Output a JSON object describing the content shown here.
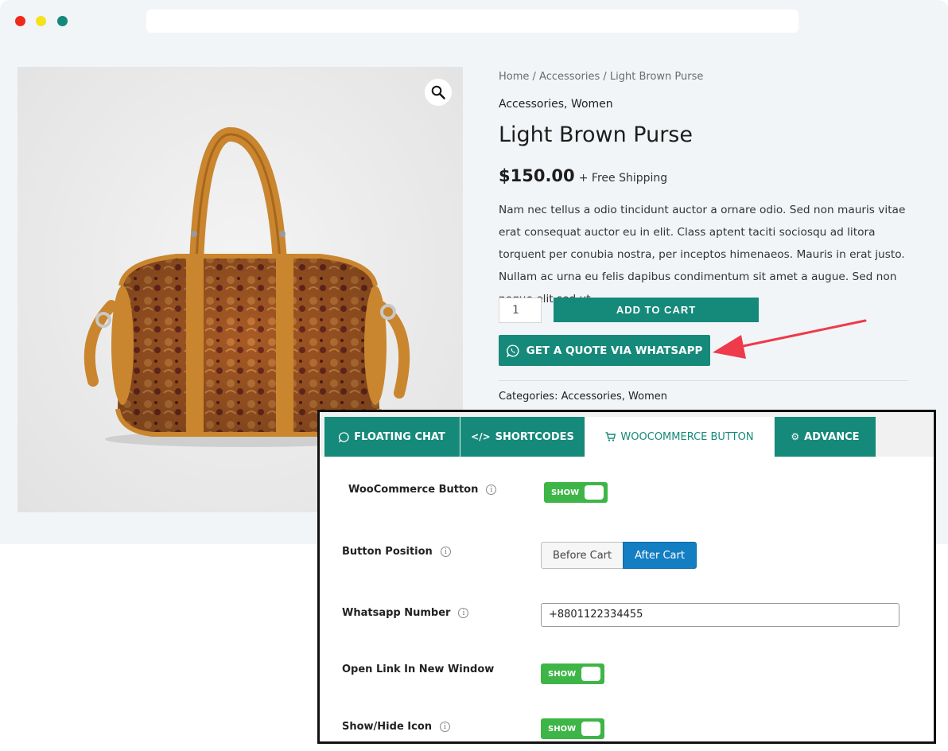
{
  "browser": {
    "address": ""
  },
  "product": {
    "breadcrumb": {
      "home": "Home",
      "sep1": " / ",
      "category": "Accessories",
      "sep2": " / ",
      "current": "Light Brown Purse"
    },
    "categories_top": "Accessories, Women",
    "title": "Light Brown Purse",
    "price": "$150.00",
    "shipping": "+ Free Shipping",
    "description": "Nam nec tellus a odio tincidunt auctor a ornare odio. Sed non mauris vitae erat consequat auctor eu in elit. Class aptent taciti sociosqu ad litora torquent per conubia nostra, per inceptos himenaeos. Mauris in erat justo. Nullam ac urna eu felis dapibus condimentum sit amet a augue. Sed non neque elit sed ut.",
    "quantity": "1",
    "add_to_cart_label": "ADD TO CART",
    "whatsapp_button_label": "GET A QUOTE VIA WHATSAPP",
    "categories_bottom": "Categories: Accessories, Women"
  },
  "settings": {
    "tabs": [
      {
        "label": "FLOATING CHAT",
        "icon": "whatsapp-icon"
      },
      {
        "label": "SHORTCODES",
        "icon": "code-icon"
      },
      {
        "label": "WOOCOMMERCE BUTTON",
        "icon": "cart-icon",
        "active": true
      },
      {
        "label": "ADVANCE",
        "icon": "gears-icon"
      }
    ],
    "woocommerce_button": {
      "label": "WooCommerce Button",
      "toggle": "SHOW"
    },
    "button_position": {
      "label": "Button Position",
      "options": [
        "Before Cart",
        "After Cart"
      ],
      "selected": "After Cart"
    },
    "whatsapp_number": {
      "label": "Whatsapp Number",
      "value": "+8801122334455"
    },
    "open_new_window": {
      "label": "Open Link In New Window",
      "toggle": "SHOW"
    },
    "show_hide_icon": {
      "label": "Show/Hide Icon",
      "toggle": "SHOW"
    }
  },
  "colors": {
    "accent": "#15897a",
    "toggle_on": "#3eb547",
    "segment_active": "#137ec2",
    "arrow": "#ee3a4a"
  }
}
